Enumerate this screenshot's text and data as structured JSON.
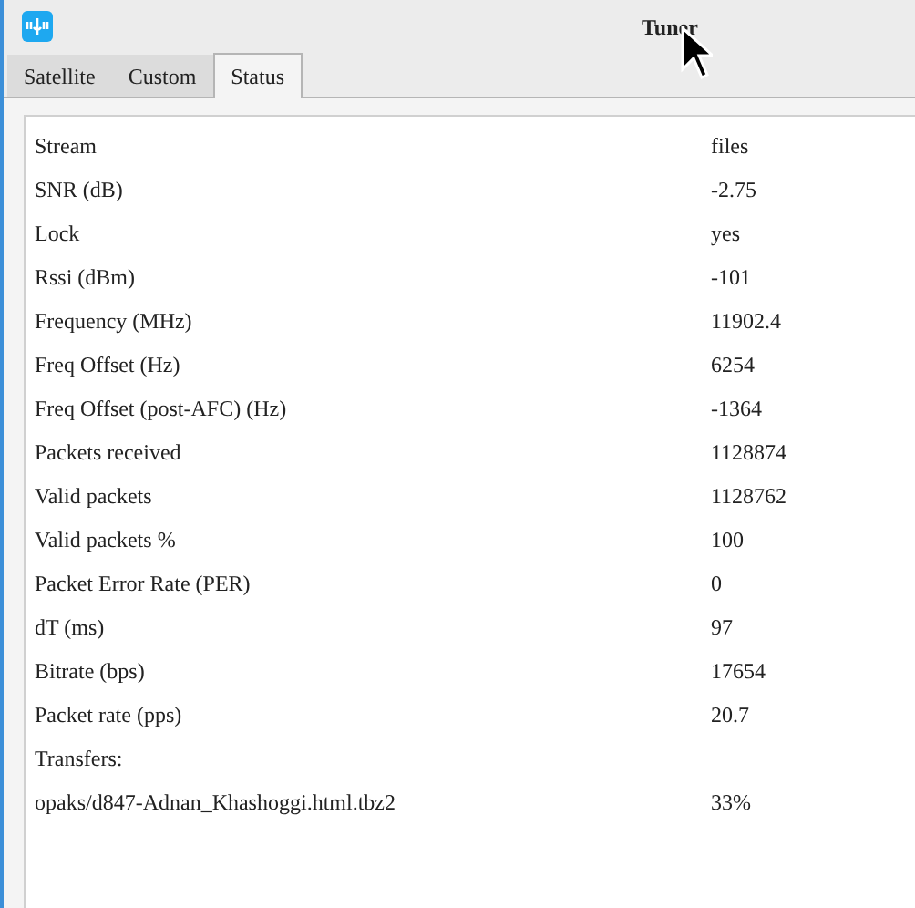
{
  "window": {
    "title": "Tuner"
  },
  "tabs": [
    {
      "label": "Satellite",
      "selected": false
    },
    {
      "label": "Custom",
      "selected": false
    },
    {
      "label": "Status",
      "selected": true
    }
  ],
  "rows": [
    {
      "label": "Stream",
      "value": "files"
    },
    {
      "label": "SNR (dB)",
      "value": "-2.75"
    },
    {
      "label": "Lock",
      "value": "yes"
    },
    {
      "label": "Rssi (dBm)",
      "value": "-101"
    },
    {
      "label": "Frequency (MHz)",
      "value": "11902.4"
    },
    {
      "label": "Freq Offset (Hz)",
      "value": "6254"
    },
    {
      "label": "Freq Offset (post-AFC) (Hz)",
      "value": "-1364"
    },
    {
      "label": "Packets received",
      "value": "1128874"
    },
    {
      "label": "Valid packets",
      "value": "1128762"
    },
    {
      "label": "Valid packets %",
      "value": "100"
    },
    {
      "label": "Packet Error Rate (PER)",
      "value": "0"
    },
    {
      "label": "dT (ms)",
      "value": "97"
    },
    {
      "label": "Bitrate (bps)",
      "value": "17654"
    },
    {
      "label": "Packet rate (pps)",
      "value": "20.7"
    },
    {
      "label": "Transfers:"
    },
    {
      "label": "opaks/d847-Adnan_Khashoggi.html.tbz2",
      "value": "33%"
    }
  ]
}
